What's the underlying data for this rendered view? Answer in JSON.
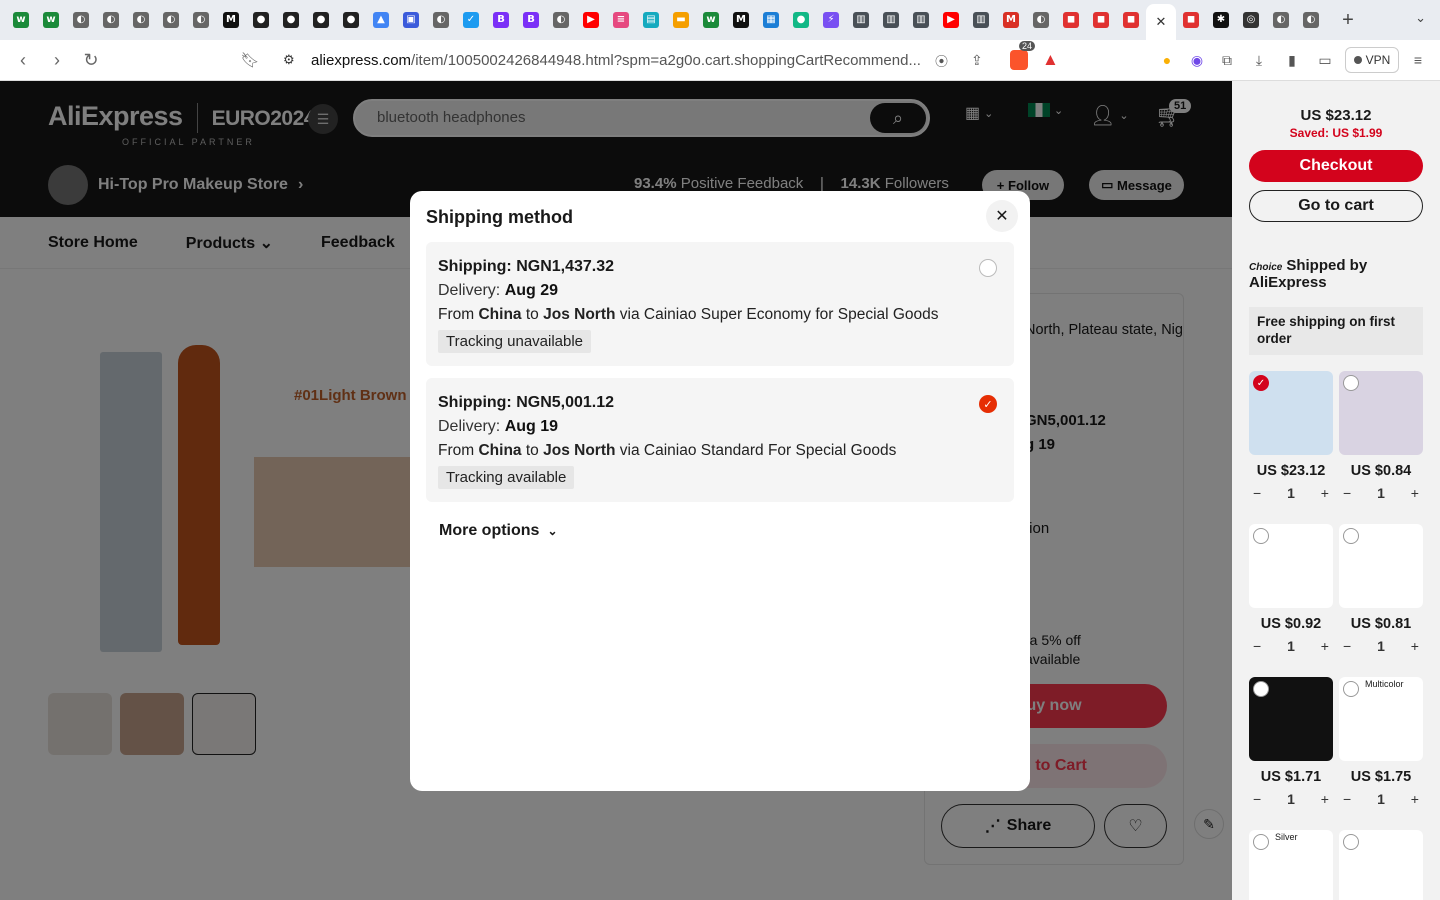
{
  "browser": {
    "url_domain": "aliexpress.com",
    "url_rest": "/item/1005002426844948.html?spm=a2g0o.cart.shoppingCartRecommend...",
    "vpn_label": "VPN",
    "brave_badge": "24",
    "tabs": [
      {
        "icon": "w",
        "color": "#1b8a3a"
      },
      {
        "icon": "w",
        "color": "#1b8a3a"
      },
      {
        "icon": "◐",
        "color": "#666"
      },
      {
        "icon": "◐",
        "color": "#666"
      },
      {
        "icon": "◐",
        "color": "#666"
      },
      {
        "icon": "◐",
        "color": "#666"
      },
      {
        "icon": "◐",
        "color": "#666"
      },
      {
        "icon": "M",
        "color": "#111"
      },
      {
        "icon": "●",
        "color": "#222"
      },
      {
        "icon": "●",
        "color": "#222"
      },
      {
        "icon": "●",
        "color": "#222"
      },
      {
        "icon": "●",
        "color": "#222"
      },
      {
        "icon": "▲",
        "color": "#4285f4"
      },
      {
        "icon": "▣",
        "color": "#3b5bdb"
      },
      {
        "icon": "◐",
        "color": "#666"
      },
      {
        "icon": "✓",
        "color": "#1d9bf0"
      },
      {
        "icon": "B",
        "color": "#7b2ff7"
      },
      {
        "icon": "B",
        "color": "#7b2ff7"
      },
      {
        "icon": "◐",
        "color": "#666"
      },
      {
        "icon": "▶",
        "color": "#ff0000"
      },
      {
        "icon": "≡",
        "color": "#e64980"
      },
      {
        "icon": "▤",
        "color": "#15aabf"
      },
      {
        "icon": "▬",
        "color": "#f59f00"
      },
      {
        "icon": "w",
        "color": "#1b8a3a"
      },
      {
        "icon": "M",
        "color": "#111"
      },
      {
        "icon": "▦",
        "color": "#1c7ed6"
      },
      {
        "icon": "●",
        "color": "#12b886"
      },
      {
        "icon": "⚡",
        "color": "#7950f2"
      },
      {
        "icon": "▥",
        "color": "#495057"
      },
      {
        "icon": "▥",
        "color": "#495057"
      },
      {
        "icon": "▥",
        "color": "#495057"
      },
      {
        "icon": "▶",
        "color": "#ff0000"
      },
      {
        "icon": "▥",
        "color": "#495057"
      },
      {
        "icon": "M",
        "color": "#d93025"
      },
      {
        "icon": "◐",
        "color": "#666"
      },
      {
        "icon": "◼",
        "color": "#e03131"
      },
      {
        "icon": "◼",
        "color": "#e03131"
      },
      {
        "icon": "◼",
        "color": "#e03131"
      },
      {
        "icon": "✕",
        "color": "#333",
        "active": true
      },
      {
        "icon": "◼",
        "color": "#e03131"
      },
      {
        "icon": "✱",
        "color": "#111"
      },
      {
        "icon": "◎",
        "color": "#333"
      },
      {
        "icon": "◐",
        "color": "#666"
      },
      {
        "icon": "◐",
        "color": "#666"
      }
    ]
  },
  "header": {
    "logo": "AliExpress",
    "euro": "EURO2024",
    "official": "OFFICIAL PARTNER",
    "search_value": "bluetooth headphones",
    "cart_count": "51"
  },
  "store": {
    "name": "Hi-Top Pro Makeup Store",
    "feedback_pct": "93.4%",
    "feedback_label": "Positive Feedback",
    "followers": "14.3K",
    "followers_label": "Followers",
    "follow_label": "Follow",
    "message_label": "Message",
    "nav": [
      "Store Home",
      "Products",
      "Feedback"
    ]
  },
  "product_bg": {
    "variant_label": "#01Light Brown",
    "ship_to_snippet": "North, Plateau state, Nig",
    "price_snippet": "GN5,001.12",
    "date_snippet": "g 19",
    "option_snippet": "tion",
    "discount_snippet_1": "ra 5% off",
    "discount_snippet_2": "available",
    "buy_now": "uy now",
    "add_to_cart": "d to Cart",
    "share": "Share"
  },
  "modal": {
    "title": "Shipping method",
    "options": [
      {
        "shipping": "Shipping: NGN1,437.32",
        "delivery_label": "Delivery:",
        "delivery_date": "Aug 29",
        "from": "From",
        "origin": "China",
        "to": "to",
        "dest": "Jos North",
        "via": "via Cainiao Super Economy for Special Goods",
        "tracking": "Tracking unavailable",
        "selected": false
      },
      {
        "shipping": "Shipping: NGN5,001.12",
        "delivery_label": "Delivery:",
        "delivery_date": "Aug 19",
        "from": "From",
        "origin": "China",
        "to": "to",
        "dest": "Jos North",
        "via": "via Cainiao Standard For Special Goods",
        "tracking": "Tracking available",
        "selected": true
      }
    ],
    "more_options": "More options"
  },
  "cart_sidebar": {
    "total": "US $23.12",
    "saved": "Saved: US $1.99",
    "checkout": "Checkout",
    "go_to_cart": "Go to cart",
    "choice_label": "Choice",
    "shipped_by": "Shipped by AliExpress",
    "free_shipping": "Free shipping on first order",
    "items": [
      {
        "price": "US $23.12",
        "qty": "1",
        "checked": true,
        "label": ""
      },
      {
        "price": "US $0.84",
        "qty": "1",
        "checked": false,
        "label": ""
      },
      {
        "price": "US $0.92",
        "qty": "1",
        "checked": false,
        "label": ""
      },
      {
        "price": "US $0.81",
        "qty": "1",
        "checked": false,
        "label": ""
      },
      {
        "price": "US $1.71",
        "qty": "1",
        "checked": false,
        "label": ""
      },
      {
        "price": "US $1.75",
        "qty": "1",
        "checked": false,
        "label": "Multicolor"
      },
      {
        "price": "",
        "qty": "",
        "checked": false,
        "label": "Silver"
      },
      {
        "price": "",
        "qty": "",
        "checked": false,
        "label": ""
      }
    ]
  },
  "colors": {
    "accent_red": "#d3031c",
    "select_red": "#fd384f",
    "header_dark": "#191919"
  }
}
